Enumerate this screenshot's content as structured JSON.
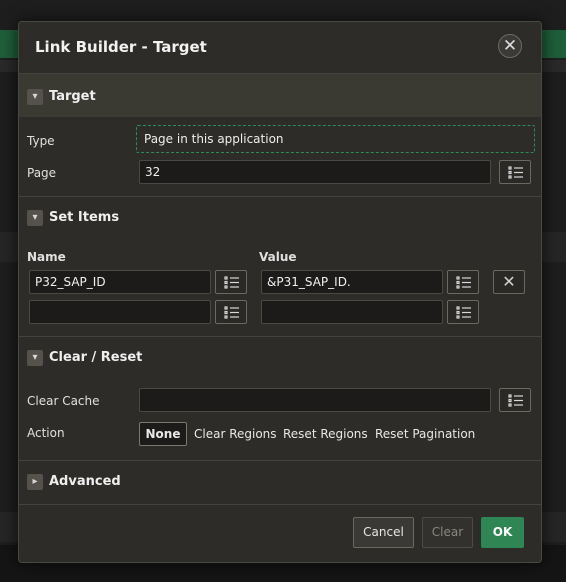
{
  "dialog": {
    "title": "Link Builder - Target",
    "close_icon": "close-icon"
  },
  "target": {
    "title": "Target",
    "type_label": "Type",
    "type_value": "Page in this application",
    "page_label": "Page",
    "page_value": "32"
  },
  "set_items": {
    "title": "Set Items",
    "name_header": "Name",
    "value_header": "Value",
    "rows": [
      {
        "name": "P32_SAP_ID",
        "value": "&P31_SAP_ID."
      },
      {
        "name": "",
        "value": ""
      }
    ]
  },
  "clear_reset": {
    "title": "Clear / Reset",
    "clear_cache_label": "Clear Cache",
    "clear_cache_value": "",
    "action_label": "Action",
    "actions": [
      "None",
      "Clear Regions",
      "Reset Regions",
      "Reset Pagination"
    ],
    "selected_action": "None"
  },
  "advanced": {
    "title": "Advanced"
  },
  "footer": {
    "cancel": "Cancel",
    "clear": "Clear",
    "ok": "OK"
  },
  "colors": {
    "accent": "#2f8553",
    "dialog_bg": "#2e2c28",
    "field_bg": "#1c1b19"
  }
}
